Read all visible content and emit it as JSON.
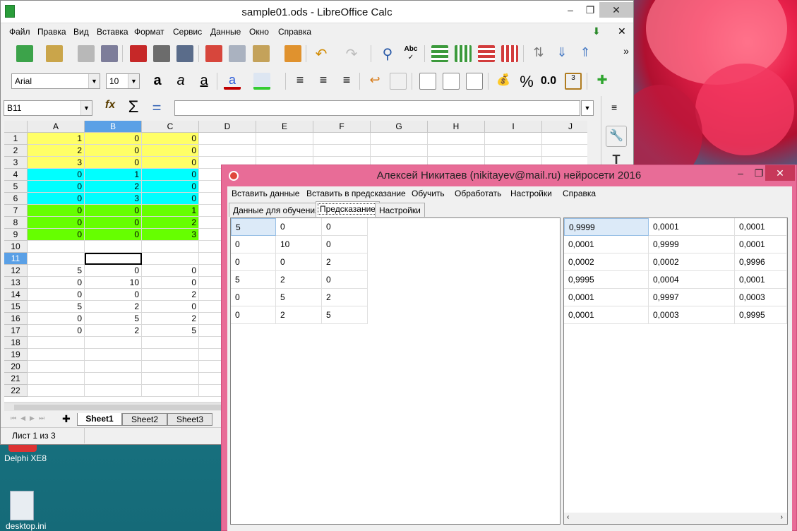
{
  "calc": {
    "title": "sample01.ods - LibreOffice Calc",
    "menu": [
      "Файл",
      "Правка",
      "Вид",
      "Вставка",
      "Формат",
      "Сервис",
      "Данные",
      "Окно",
      "Справка"
    ],
    "font_name": "Arial",
    "font_size": "10",
    "cell_ref": "B11",
    "columns": [
      "A",
      "B",
      "C",
      "D",
      "E",
      "F",
      "G",
      "H",
      "I",
      "J"
    ],
    "rows": [
      "1",
      "2",
      "3",
      "4",
      "5",
      "6",
      "7",
      "8",
      "9",
      "10",
      "11",
      "12",
      "13",
      "14",
      "15",
      "16",
      "17",
      "18",
      "19",
      "20",
      "21",
      "22"
    ],
    "cells": [
      [
        "1",
        "0",
        "0"
      ],
      [
        "2",
        "0",
        "0"
      ],
      [
        "3",
        "0",
        "0"
      ],
      [
        "0",
        "1",
        "0"
      ],
      [
        "0",
        "2",
        "0"
      ],
      [
        "0",
        "3",
        "0"
      ],
      [
        "0",
        "0",
        "1"
      ],
      [
        "0",
        "0",
        "2"
      ],
      [
        "0",
        "0",
        "3"
      ],
      [
        "",
        "",
        ""
      ],
      [
        "",
        "",
        ""
      ],
      [
        "5",
        "0",
        "0"
      ],
      [
        "0",
        "10",
        "0"
      ],
      [
        "0",
        "0",
        "2"
      ],
      [
        "5",
        "2",
        "0"
      ],
      [
        "0",
        "5",
        "2"
      ],
      [
        "0",
        "2",
        "5"
      ]
    ],
    "row_colors": [
      "#ffff66",
      "#ffff66",
      "#ffff66",
      "#00ffff",
      "#00ffff",
      "#00ffff",
      "#66ff00",
      "#66ff00",
      "#66ff00"
    ],
    "sheets": [
      "Sheet1",
      "Sheet2",
      "Sheet3"
    ],
    "status": "Лист 1 из 3"
  },
  "desktop": {
    "icon1": "Delphi XE8",
    "icon2": "desktop.ini"
  },
  "dialog": {
    "title": "Алексей Никитаев (nikitayev@mail.ru) нейросети 2016",
    "menu": [
      "Вставить данные",
      "Вставить в предсказание",
      "Обучить",
      "Обработать",
      "Настройки",
      "Справка"
    ],
    "tabs": [
      "Данные для обучения",
      "Предсказание",
      "Настройки"
    ],
    "left_grid": [
      [
        "5",
        "0",
        "0"
      ],
      [
        "0",
        "10",
        "0"
      ],
      [
        "0",
        "0",
        "2"
      ],
      [
        "5",
        "2",
        "0"
      ],
      [
        "0",
        "5",
        "2"
      ],
      [
        "0",
        "2",
        "5"
      ]
    ],
    "right_grid": [
      [
        "0,9999",
        "0,0001",
        "0,0001"
      ],
      [
        "0,0001",
        "0,9999",
        "0,0001"
      ],
      [
        "0,0002",
        "0,0002",
        "0,9996"
      ],
      [
        "0,9995",
        "0,0004",
        "0,0001"
      ],
      [
        "0,0001",
        "0,9997",
        "0,0003"
      ],
      [
        "0,0001",
        "0,0003",
        "0,9995"
      ]
    ]
  }
}
